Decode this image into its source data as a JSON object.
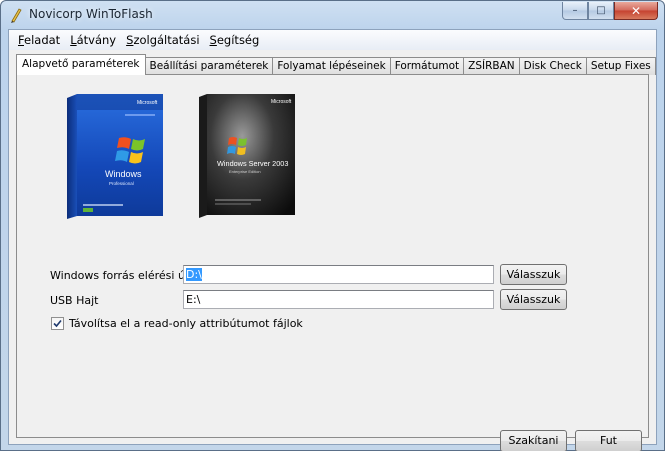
{
  "window": {
    "title": "Novicorp WinToFlash",
    "caption_buttons": {
      "minimize": "–",
      "maximize": "□",
      "close": "✕"
    }
  },
  "menu": [
    {
      "prefix": "",
      "underline": "F",
      "rest": "eladat"
    },
    {
      "prefix": "",
      "underline": "L",
      "rest": "átvány"
    },
    {
      "prefix": "",
      "underline": "S",
      "rest": "zolgáltatási"
    },
    {
      "prefix": "",
      "underline": "S",
      "rest": "egítség"
    }
  ],
  "tabs": [
    "Alapvető paraméterek",
    "Beállítási paraméterek",
    "Folyamat lépéseinek",
    "Formátumot",
    "ZSÍRBAN",
    "Disk Check",
    "Setup Fixes"
  ],
  "active_tab_index": 0,
  "images": {
    "box1": {
      "brand": "Microsoft",
      "product": "Windows",
      "edition": "Professional",
      "accent": "#1e5fc8"
    },
    "box2": {
      "brand": "Microsoft",
      "product": "Windows Server 2003",
      "edition": "Enterprise Edition",
      "accent": "#2a2a2a"
    }
  },
  "form": {
    "source_label": "Windows forrás elérési útja",
    "source_value": "D:\\",
    "source_browse": "Válasszuk",
    "usb_label": "USB Hajt",
    "usb_value": "E:\\",
    "usb_browse": "Válasszuk",
    "readonly_checkbox_label": "Távolítsa el a read-only attribútumot fájlok",
    "readonly_checked": true
  },
  "actions": {
    "cancel": "Szakítani",
    "run": "Fut"
  }
}
